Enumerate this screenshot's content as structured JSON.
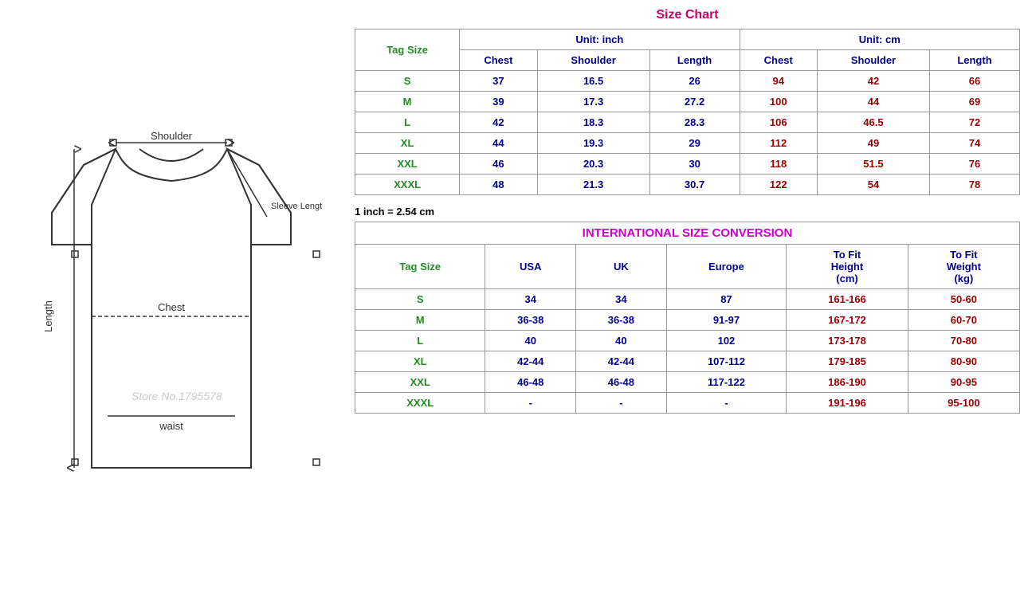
{
  "left": {
    "labels": {
      "shoulder": "Shoulder",
      "sleeve_length": "Sleeve Length",
      "chest": "Chest",
      "length": "Length",
      "waist": "waist"
    }
  },
  "right": {
    "size_chart_title": "Size Chart",
    "inch_note": "1 inch = 2.54 cm",
    "unit_inch": "Unit: inch",
    "unit_cm": "Unit: cm",
    "tag_size_label": "Tag Size",
    "col_headers_inch": [
      "Chest",
      "Shoulder",
      "Length"
    ],
    "col_headers_cm": [
      "Chest",
      "Shoulder",
      "Length"
    ],
    "size_rows": [
      {
        "tag": "S",
        "chest_in": "37",
        "shoulder_in": "16.5",
        "length_in": "26",
        "chest_cm": "94",
        "shoulder_cm": "42",
        "length_cm": "66"
      },
      {
        "tag": "M",
        "chest_in": "39",
        "shoulder_in": "17.3",
        "length_in": "27.2",
        "chest_cm": "100",
        "shoulder_cm": "44",
        "length_cm": "69"
      },
      {
        "tag": "L",
        "chest_in": "42",
        "shoulder_in": "18.3",
        "length_in": "28.3",
        "chest_cm": "106",
        "shoulder_cm": "46.5",
        "length_cm": "72"
      },
      {
        "tag": "XL",
        "chest_in": "44",
        "shoulder_in": "19.3",
        "length_in": "29",
        "chest_cm": "112",
        "shoulder_cm": "49",
        "length_cm": "74"
      },
      {
        "tag": "XXL",
        "chest_in": "46",
        "shoulder_in": "20.3",
        "length_in": "30",
        "chest_cm": "118",
        "shoulder_cm": "51.5",
        "length_cm": "76"
      },
      {
        "tag": "XXXL",
        "chest_in": "48",
        "shoulder_in": "21.3",
        "length_in": "30.7",
        "chest_cm": "122",
        "shoulder_cm": "54",
        "length_cm": "78"
      }
    ],
    "conversion_title": "INTERNATIONAL SIZE CONVERSION",
    "conv_tag_size_label": "Tag Size",
    "conv_col_headers": [
      "USA",
      "UK",
      "Europe",
      "To Fit Height (cm)",
      "To Fit Weight (kg)"
    ],
    "conv_rows": [
      {
        "tag": "S",
        "usa": "34",
        "uk": "34",
        "europe": "87",
        "height": "161-166",
        "weight": "50-60"
      },
      {
        "tag": "M",
        "usa": "36-38",
        "uk": "36-38",
        "europe": "91-97",
        "height": "167-172",
        "weight": "60-70"
      },
      {
        "tag": "L",
        "usa": "40",
        "uk": "40",
        "europe": "102",
        "height": "173-178",
        "weight": "70-80"
      },
      {
        "tag": "XL",
        "usa": "42-44",
        "uk": "42-44",
        "europe": "107-112",
        "height": "179-185",
        "weight": "80-90"
      },
      {
        "tag": "XXL",
        "usa": "46-48",
        "uk": "46-48",
        "europe": "117-122",
        "height": "186-190",
        "weight": "90-95"
      },
      {
        "tag": "XXXL",
        "usa": "-",
        "uk": "-",
        "europe": "-",
        "height": "191-196",
        "weight": "95-100"
      }
    ]
  }
}
